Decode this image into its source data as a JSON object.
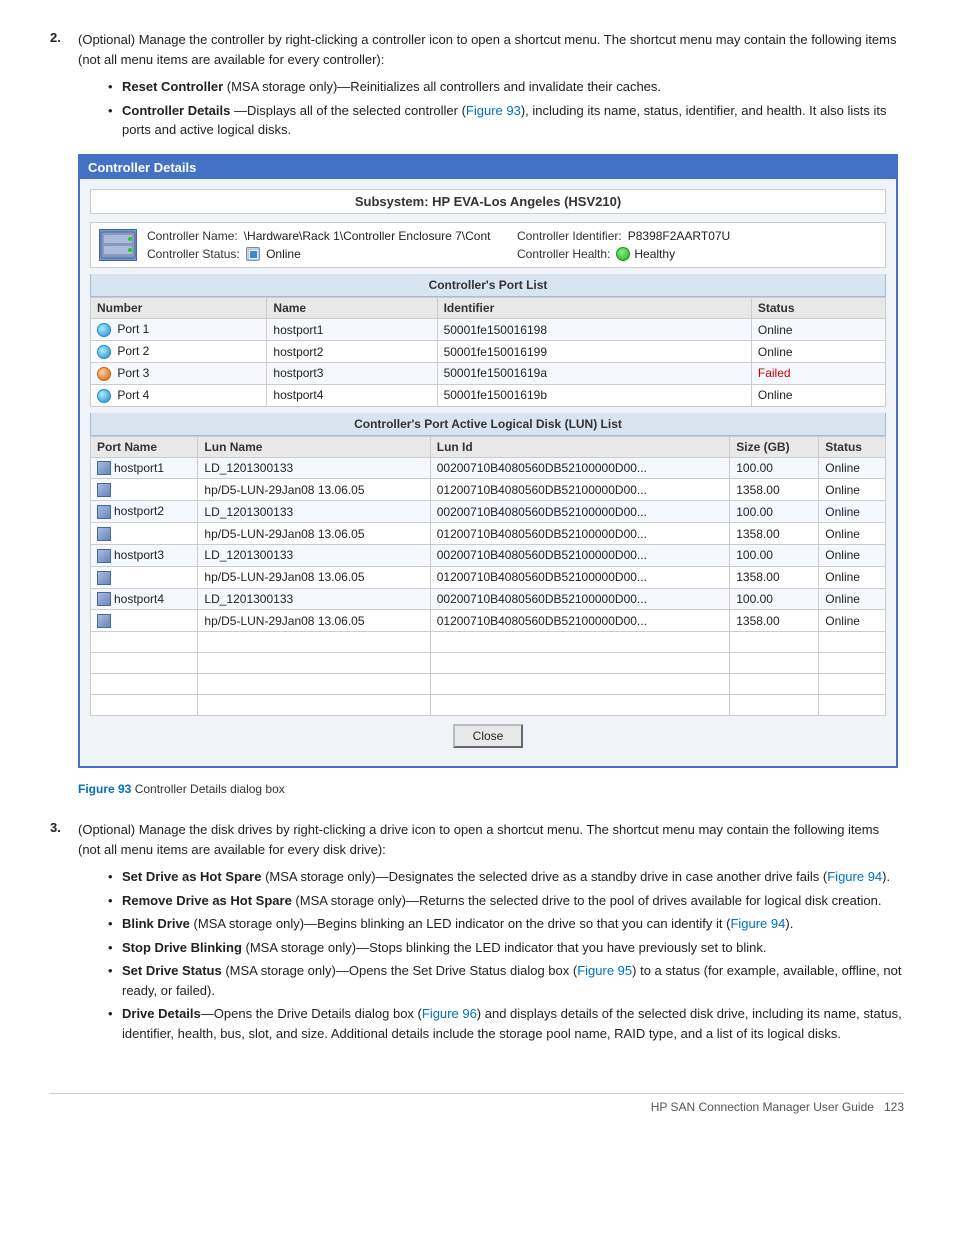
{
  "steps": [
    {
      "number": "2.",
      "text": "(Optional) Manage the controller by right-clicking a controller icon to open a shortcut menu. The shortcut menu may contain the following items (not all menu items are available for every controller):",
      "bullets": [
        {
          "bold": "Reset Controller",
          "rest": " (MSA storage only)—Reinitializes all controllers and invalidate their caches."
        },
        {
          "bold": "Controller Details",
          "rest": "—Displays all of the selected controller (",
          "link": "Figure 93",
          "after": "), including its name, status, identifier, and health. It also lists its ports and active logical disks."
        }
      ]
    },
    {
      "number": "3.",
      "text": "(Optional) Manage the disk drives by right-clicking a drive icon to open a shortcut menu. The shortcut menu may contain the following items (not all menu items are available for every disk drive):",
      "bullets": [
        {
          "bold": "Set Drive as Hot Spare",
          "rest": " (MSA storage only)—Designates the selected drive as a standby drive in case another drive fails (",
          "link": "Figure 94",
          "after": ")."
        },
        {
          "bold": "Remove Drive as Hot Spare",
          "rest": " (MSA storage only)—Returns the selected drive to the pool of drives available for logical disk creation."
        },
        {
          "bold": "Blink Drive",
          "rest": " (MSA storage only)—Begins blinking an LED indicator on the drive so that you can identify it (",
          "link": "Figure 94",
          "after": ")."
        },
        {
          "bold": "Stop Drive Blinking",
          "rest": " (MSA storage only)—Stops blinking the LED indicator that you have previously set to blink."
        },
        {
          "bold": "Set Drive Status",
          "rest": " (MSA storage only)—Opens the Set Drive Status dialog box (",
          "link": "Figure 95",
          "after": ") to a status (for example, available, offline, not ready, or failed)."
        },
        {
          "bold": "Drive Details",
          "rest": "—Opens the Drive Details dialog box (",
          "link": "Figure 96",
          "after": ") and displays details of the selected disk drive, including its name, status, identifier, health, bus, slot, and size. Additional details include the storage pool name, RAID type, and a list of its logical disks."
        }
      ]
    }
  ],
  "dialog": {
    "title": "Controller Details",
    "subsystem": "Subsystem: HP EVA-Los Angeles (HSV210)",
    "controller_name_label": "Controller Name:",
    "controller_name_value": "\\Hardware\\Rack 1\\Controller Enclosure 7\\Cont",
    "controller_status_label": "Controller Status:",
    "controller_status_value": "Online",
    "controller_id_label": "Controller Identifier:",
    "controller_id_value": "P8398F2AART07U",
    "controller_health_label": "Controller Health:",
    "controller_health_value": "Healthy",
    "port_list_header": "Controller's Port List",
    "port_columns": [
      "Number",
      "Name",
      "Identifier",
      "Status"
    ],
    "ports": [
      {
        "number": "Port 1",
        "name": "hostport1",
        "identifier": "50001fe150016198",
        "status": "Online",
        "icon": "green"
      },
      {
        "number": "Port 2",
        "name": "hostport2",
        "identifier": "50001fe150016199",
        "status": "Online",
        "icon": "green"
      },
      {
        "number": "Port 3",
        "name": "hostport3",
        "identifier": "50001fe15001619a",
        "status": "Failed",
        "icon": "orange"
      },
      {
        "number": "Port 4",
        "name": "hostport4",
        "identifier": "50001fe15001619b",
        "status": "Online",
        "icon": "green"
      }
    ],
    "lun_list_header": "Controller's Port Active Logical Disk (LUN) List",
    "lun_columns": [
      "Port Name",
      "Lun Name",
      "Lun Id",
      "Size (GB)",
      "Status"
    ],
    "luns": [
      {
        "port": "hostport1",
        "lun_name": "LD_1201300133",
        "lun_id": "00200710B4080560DB52100000D00...",
        "size": "100.00",
        "status": "Online",
        "has_port_icon": true
      },
      {
        "port": "",
        "lun_name": "hp/D5-LUN-29Jan08 13.06.05",
        "lun_id": "01200710B4080560DB52100000D00...",
        "size": "1358.00",
        "status": "Online",
        "has_port_icon": false
      },
      {
        "port": "hostport2",
        "lun_name": "LD_1201300133",
        "lun_id": "00200710B4080560DB52100000D00...",
        "size": "100.00",
        "status": "Online",
        "has_port_icon": true
      },
      {
        "port": "",
        "lun_name": "hp/D5-LUN-29Jan08 13.06.05",
        "lun_id": "01200710B4080560DB52100000D00...",
        "size": "1358.00",
        "status": "Online",
        "has_port_icon": false
      },
      {
        "port": "hostport3",
        "lun_name": "LD_1201300133",
        "lun_id": "00200710B4080560DB52100000D00...",
        "size": "100.00",
        "status": "Online",
        "has_port_icon": true
      },
      {
        "port": "",
        "lun_name": "hp/D5-LUN-29Jan08 13.06.05",
        "lun_id": "01200710B4080560DB52100000D00...",
        "size": "1358.00",
        "status": "Online",
        "has_port_icon": false
      },
      {
        "port": "hostport4",
        "lun_name": "LD_1201300133",
        "lun_id": "00200710B4080560DB52100000D00...",
        "size": "100.00",
        "status": "Online",
        "has_port_icon": true
      },
      {
        "port": "",
        "lun_name": "hp/D5-LUN-29Jan08 13.06.05",
        "lun_id": "01200710B4080560DB52100000D00...",
        "size": "1358.00",
        "status": "Online",
        "has_port_icon": false
      }
    ],
    "empty_rows": 4,
    "close_button": "Close"
  },
  "figure_caption": {
    "label": "Figure 93",
    "description": "  Controller Details dialog box"
  },
  "page_footer": {
    "guide": "HP SAN Connection Manager User Guide",
    "page": "123"
  }
}
